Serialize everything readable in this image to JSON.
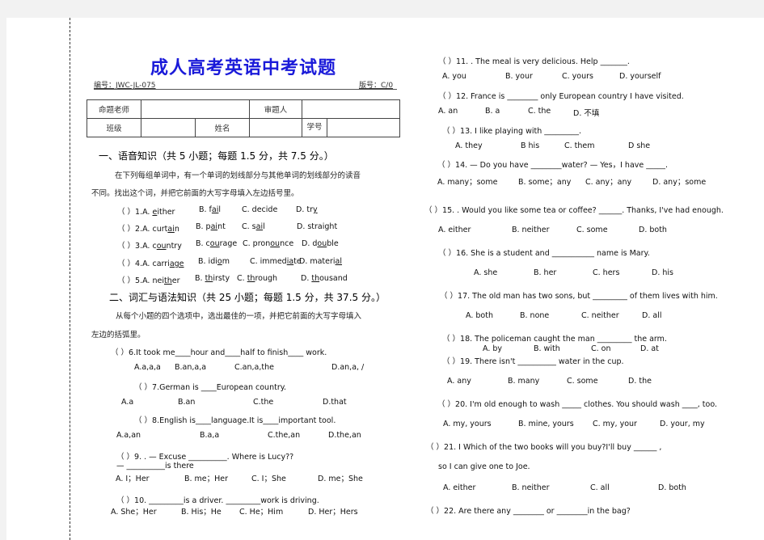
{
  "title": "成人高考英语中考试题",
  "doc_number": "编号：JWC-JL-075",
  "version_number": "版号：C/0",
  "info_table": {
    "row1": [
      "命题老师",
      "",
      "审题人",
      ""
    ],
    "row2": [
      "班级",
      "",
      "姓名",
      "",
      "学号",
      ""
    ]
  },
  "section1": {
    "heading": "一、语音知识（共 5 小题；每题 1.5 分，共 7.5 分。）",
    "instruction_line1": "在下列每组单词中，有一个单词的划线部分与其他单词的划线部分的读音",
    "instruction_line2": "不同。找出这个词，并把它前面的大写字母填入左边括号里。",
    "questions": [
      {
        "prefix": "（ ）1.A. ",
        "options": [
          [
            "",
            "e",
            "ither"
          ],
          [
            "B. f",
            "ai",
            "l"
          ],
          [
            "C. deci",
            "",
            "de"
          ],
          [
            "D. tr",
            "y",
            ""
          ]
        ]
      },
      {
        "prefix": "（ ）2.A. ",
        "options": [
          [
            "curt",
            "ai",
            "n"
          ],
          [
            "B. p",
            "ai",
            "nt"
          ],
          [
            "C. s",
            "ai",
            "l"
          ],
          [
            "D. straight",
            "",
            ""
          ]
        ]
      },
      {
        "prefix": "（ ）3.A. ",
        "options": [
          [
            "c",
            "ou",
            "ntry"
          ],
          [
            "B. c",
            "ou",
            "rage"
          ],
          [
            "C. pron",
            "ou",
            "nce"
          ],
          [
            "D. d",
            "ou",
            "ble"
          ]
        ]
      },
      {
        "prefix": "（ ）4.A. ",
        "options": [
          [
            "carri",
            "age",
            ""
          ],
          [
            "B. idi",
            "o",
            "m"
          ],
          [
            "C. immed",
            "ia",
            "te"
          ],
          [
            "D. materi",
            "al",
            ""
          ]
        ]
      },
      {
        "prefix": "（ ）5.A. ",
        "options": [
          [
            "nei",
            "th",
            "er"
          ],
          [
            "B. ",
            "th",
            "irsty"
          ],
          [
            "C. ",
            "th",
            "rough"
          ],
          [
            "D. ",
            "th",
            "ousand"
          ]
        ]
      }
    ]
  },
  "section2": {
    "heading": "二、词汇与语法知识（共 25 小题；每题 1.5 分，共 37.5 分。）",
    "instruction_line1": "从每个小题的四个选项中，选出最佳的一项，并把它前面的大写字母填入",
    "instruction_line2": "左边的括弧里。"
  },
  "left_questions": {
    "q6": {
      "stem": "（ ）6.It took me____hour and____half to finish____   work.",
      "options": [
        "A.a,a,a",
        "B.an,a,a",
        "C.an,a,the",
        "D.an,a, /"
      ]
    },
    "q7": {
      "stem": "（ ）7.German is ____European country.",
      "options": [
        "A.a",
        "B.an",
        "C.the",
        "D.that"
      ]
    },
    "q8": {
      "stem": "（ ）8.English is____language.It is____important tool.",
      "options": [
        "A.a,an",
        "B.a,a",
        "C.the,an",
        "D.the,an"
      ]
    },
    "q9": {
      "stem": "（ ）9. . — Excuse __________. Where is Lucy??",
      "stem2": "— __________is there",
      "options": [
        "A. I；Her",
        "B. me；Her",
        "C. I；She",
        "D. me；She"
      ]
    },
    "q10": {
      "stem": "（ ）10. _________is a driver. _________work is driving.",
      "options": [
        "A. She；Her",
        "B. His；He",
        "C. He；Him",
        "D. Her；Hers"
      ]
    }
  },
  "right_questions": {
    "q11": {
      "stem": "（ ）11. . The meal is very delicious.  Help _______.",
      "options": [
        "A. you",
        "B. your",
        "C. yours",
        "D. yourself"
      ]
    },
    "q12": {
      "stem": "（ ）12. France is ________ only European country I have visited.",
      "options": [
        "A. an",
        "B. a",
        "C. the",
        "D. 不填"
      ]
    },
    "q13": {
      "stem": "（ ）13. I like playing with _________.",
      "options": [
        "A. they",
        "B his",
        "C. them",
        "D she"
      ]
    },
    "q14": {
      "stem": "（ ）14. — Do you have ________water?  — Yes，I have _____.",
      "options": [
        "A. many；some",
        "B. some；any",
        "C. any；any",
        "D. any；some"
      ]
    },
    "q15": {
      "stem": "（ ）15. . Would you like some tea or coffee? ______. Thanks, I've had enough.",
      "options": [
        "A. either",
        "B. neither",
        "C. some",
        "D. both"
      ]
    },
    "q16": {
      "stem": "（ ）16. She is a student and ___________ name is Mary.",
      "options": [
        "A. she",
        "B. her",
        "C. hers",
        "D. his"
      ]
    },
    "q17": {
      "stem": "（ ）17. The old man has two sons, but _________ of them lives with him.",
      "options": [
        "A. both",
        "B. none",
        "C. neither",
        "D. all"
      ]
    },
    "q18": {
      "stem": "（ ）18. The policeman caught the man _________ the arm.",
      "options": [
        "A. by",
        "B. with",
        "C. on",
        "D. at"
      ]
    },
    "q19": {
      "stem": "（ ）19. There isn't __________ water in the cup.",
      "options": [
        "A. any",
        "B. many",
        "C. some",
        "D. the"
      ]
    },
    "q20": {
      "stem": "（ ）20. I'm old enough to wash _____   clothes. You should wash ____, too.",
      "options": [
        "A. my, yours",
        "B. mine, yours",
        "C. my, your",
        "D. your, my"
      ]
    },
    "q21": {
      "stem": "（ ）21. I Which of the two books will you buy?I'll buy ______ ,",
      "stem2": "so I can give one to Joe.",
      "options": [
        "A. either",
        "B. neither",
        "C. all",
        "D. both"
      ]
    },
    "q22": {
      "stem": "（ ）22. Are there any ________  or ________in the bag?"
    }
  }
}
